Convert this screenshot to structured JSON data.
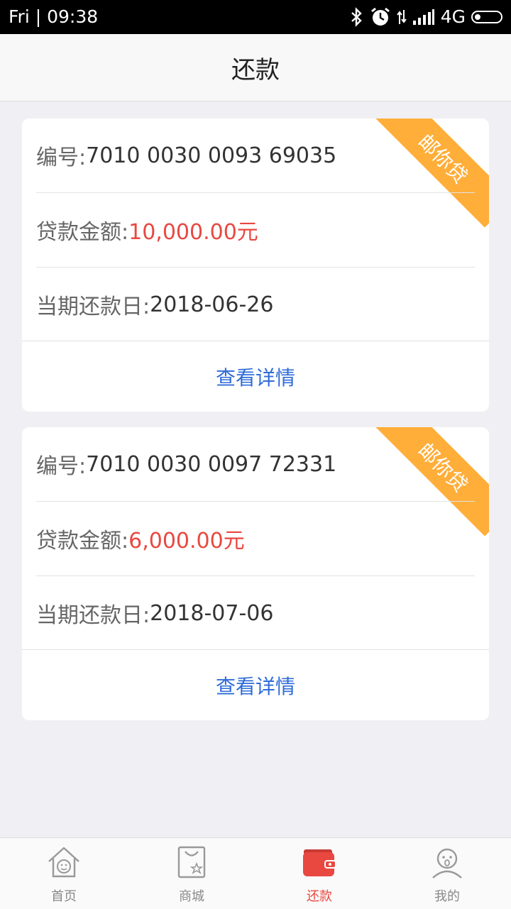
{
  "status_bar": {
    "time": "Fri | 09:38",
    "network": "4G",
    "icons": [
      "bluetooth-icon",
      "alarm-icon",
      "data-transfer-icon",
      "signal-icon",
      "battery-icon"
    ]
  },
  "header": {
    "title": "还款"
  },
  "loans": [
    {
      "badge": "邮你贷",
      "id_label": "编号: ",
      "id_value": "7010 0030 0093 69035",
      "amount_label": "贷款金额: ",
      "amount_value": "10,000.00元",
      "due_label": "当期还款日: ",
      "due_value": "2018-06-26",
      "detail_link": "查看详情"
    },
    {
      "badge": "邮你贷",
      "id_label": "编号: ",
      "id_value": "7010 0030 0097 72331",
      "amount_label": "贷款金额: ",
      "amount_value": "6,000.00元",
      "due_label": "当期还款日: ",
      "due_value": "2018-07-06",
      "detail_link": "查看详情"
    }
  ],
  "tabs": [
    {
      "label": "首页",
      "icon": "home-icon"
    },
    {
      "label": "商城",
      "icon": "shopping-bag-icon"
    },
    {
      "label": "还款",
      "icon": "wallet-icon",
      "active": true
    },
    {
      "label": "我的",
      "icon": "profile-icon"
    }
  ],
  "colors": {
    "accent": "#e84840",
    "link": "#2f6cd8",
    "ribbon": "#ffae3a",
    "background": "#f0eff4"
  }
}
